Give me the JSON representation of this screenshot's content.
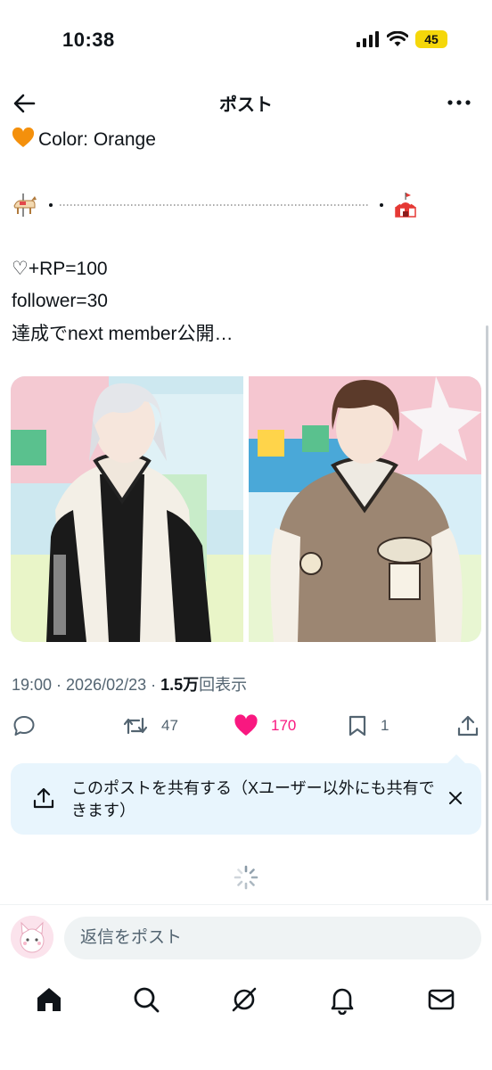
{
  "status_bar": {
    "time": "10:38",
    "battery": "45"
  },
  "nav": {
    "title": "ポスト"
  },
  "post": {
    "line_color": "Color: Orange",
    "line_rp": "♡+RP=100",
    "line_follower": "follower=30",
    "line_reveal": "達成でnext member公開…"
  },
  "meta": {
    "time": "19:00",
    "sep1": " · ",
    "date": "2026/02/23",
    "sep2": " · ",
    "views_count": "1.5万",
    "views_label": "回表示"
  },
  "actions": {
    "retweet_count": "47",
    "like_count": "170",
    "bookmark_count": "1"
  },
  "share_banner": {
    "text": "このポストを共有する（Xユーザー以外にも共有できます）"
  },
  "reply": {
    "placeholder": "返信をポスト"
  },
  "colors": {
    "like": "#f91880",
    "accent": "#1d9bf0",
    "banner_bg": "#e8f5fd",
    "orange_heart": "#f4900c"
  },
  "icons": [
    "back-arrow-icon",
    "more-icon",
    "reply-icon",
    "retweet-icon",
    "like-icon",
    "bookmark-icon",
    "share-icon",
    "close-icon",
    "home-icon",
    "search-icon",
    "grok-icon",
    "notifications-icon",
    "messages-icon"
  ]
}
